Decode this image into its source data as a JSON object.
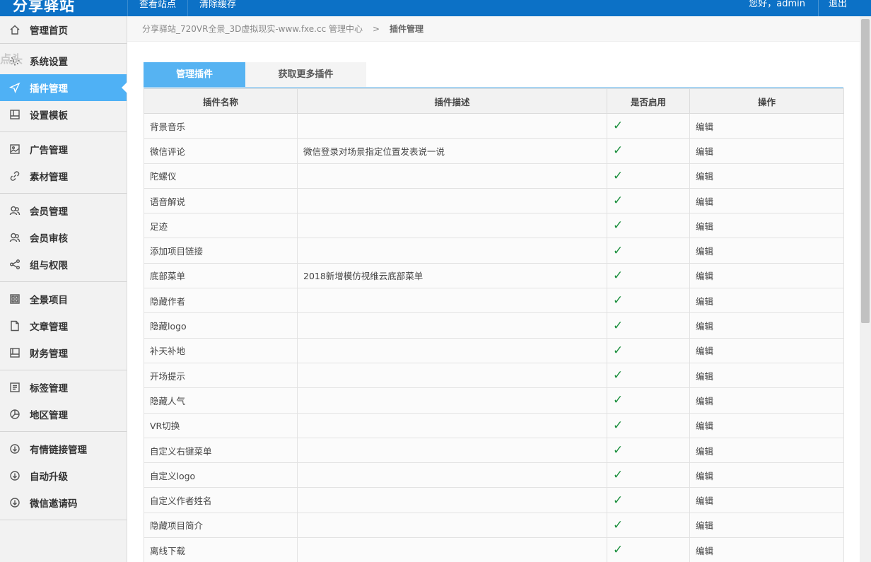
{
  "header": {
    "brand": "分享驿站",
    "nav": [
      "查看站点",
      "清除缓存"
    ],
    "greeting": "您好，admin",
    "logout": "退出"
  },
  "sidebar": {
    "faint_text": "点头",
    "groups": [
      [
        {
          "label": "管理首页",
          "icon": "home-icon"
        }
      ],
      [
        {
          "label": "系统设置",
          "icon": "gear-icon"
        },
        {
          "label": "插件管理",
          "icon": "send-icon",
          "active": true
        },
        {
          "label": "设置模板",
          "icon": "template-icon"
        }
      ],
      [
        {
          "label": "广告管理",
          "icon": "image-icon"
        },
        {
          "label": "素材管理",
          "icon": "link-icon"
        }
      ],
      [
        {
          "label": "会员管理",
          "icon": "users-icon"
        },
        {
          "label": "会员审核",
          "icon": "users-icon"
        },
        {
          "label": "组与权限",
          "icon": "share-icon"
        }
      ],
      [
        {
          "label": "全景项目",
          "icon": "grid-icon"
        },
        {
          "label": "文章管理",
          "icon": "file-icon"
        },
        {
          "label": "财务管理",
          "icon": "book-icon"
        }
      ],
      [
        {
          "label": "标签管理",
          "icon": "list-icon"
        },
        {
          "label": "地区管理",
          "icon": "pie-icon"
        }
      ],
      [
        {
          "label": "有情链接管理",
          "icon": "download-icon"
        },
        {
          "label": "自动升级",
          "icon": "download-icon"
        },
        {
          "label": "微信邀请码",
          "icon": "download-icon"
        }
      ]
    ]
  },
  "breadcrumb": {
    "root": "分享驿站_720VR全景_3D虚拟现实-www.fxe.cc 管理中心",
    "separator": ">",
    "current": "插件管理"
  },
  "tabs": [
    "管理插件",
    "获取更多插件"
  ],
  "table": {
    "headers": [
      "插件名称",
      "插件描述",
      "是否启用",
      "操作"
    ],
    "check_glyph": "✓",
    "rows": [
      {
        "name": "背景音乐",
        "desc": "",
        "action": "编辑"
      },
      {
        "name": "微信评论",
        "desc": "微信登录对场景指定位置发表说一说",
        "action": "编辑"
      },
      {
        "name": "陀螺仪",
        "desc": "",
        "action": "编辑"
      },
      {
        "name": "语音解说",
        "desc": "",
        "action": "编辑"
      },
      {
        "name": "足迹",
        "desc": "",
        "action": "编辑"
      },
      {
        "name": "添加项目链接",
        "desc": "",
        "action": "编辑"
      },
      {
        "name": "底部菜单",
        "desc": "2018新增模仿视维云底部菜单",
        "action": "编辑"
      },
      {
        "name": "隐藏作者",
        "desc": "",
        "action": "编辑"
      },
      {
        "name": "隐藏logo",
        "desc": "",
        "action": "编辑"
      },
      {
        "name": "补天补地",
        "desc": "",
        "action": "编辑"
      },
      {
        "name": "开场提示",
        "desc": "",
        "action": "编辑"
      },
      {
        "name": "隐藏人气",
        "desc": "",
        "action": "编辑"
      },
      {
        "name": "VR切换",
        "desc": "",
        "action": "编辑"
      },
      {
        "name": "自定义右键菜单",
        "desc": "",
        "action": "编辑"
      },
      {
        "name": "自定义logo",
        "desc": "",
        "action": "编辑"
      },
      {
        "name": "自定义作者姓名",
        "desc": "",
        "action": "编辑"
      },
      {
        "name": "隐藏项目简介",
        "desc": "",
        "action": "编辑"
      },
      {
        "name": "离线下载",
        "desc": "",
        "action": "编辑"
      }
    ]
  }
}
